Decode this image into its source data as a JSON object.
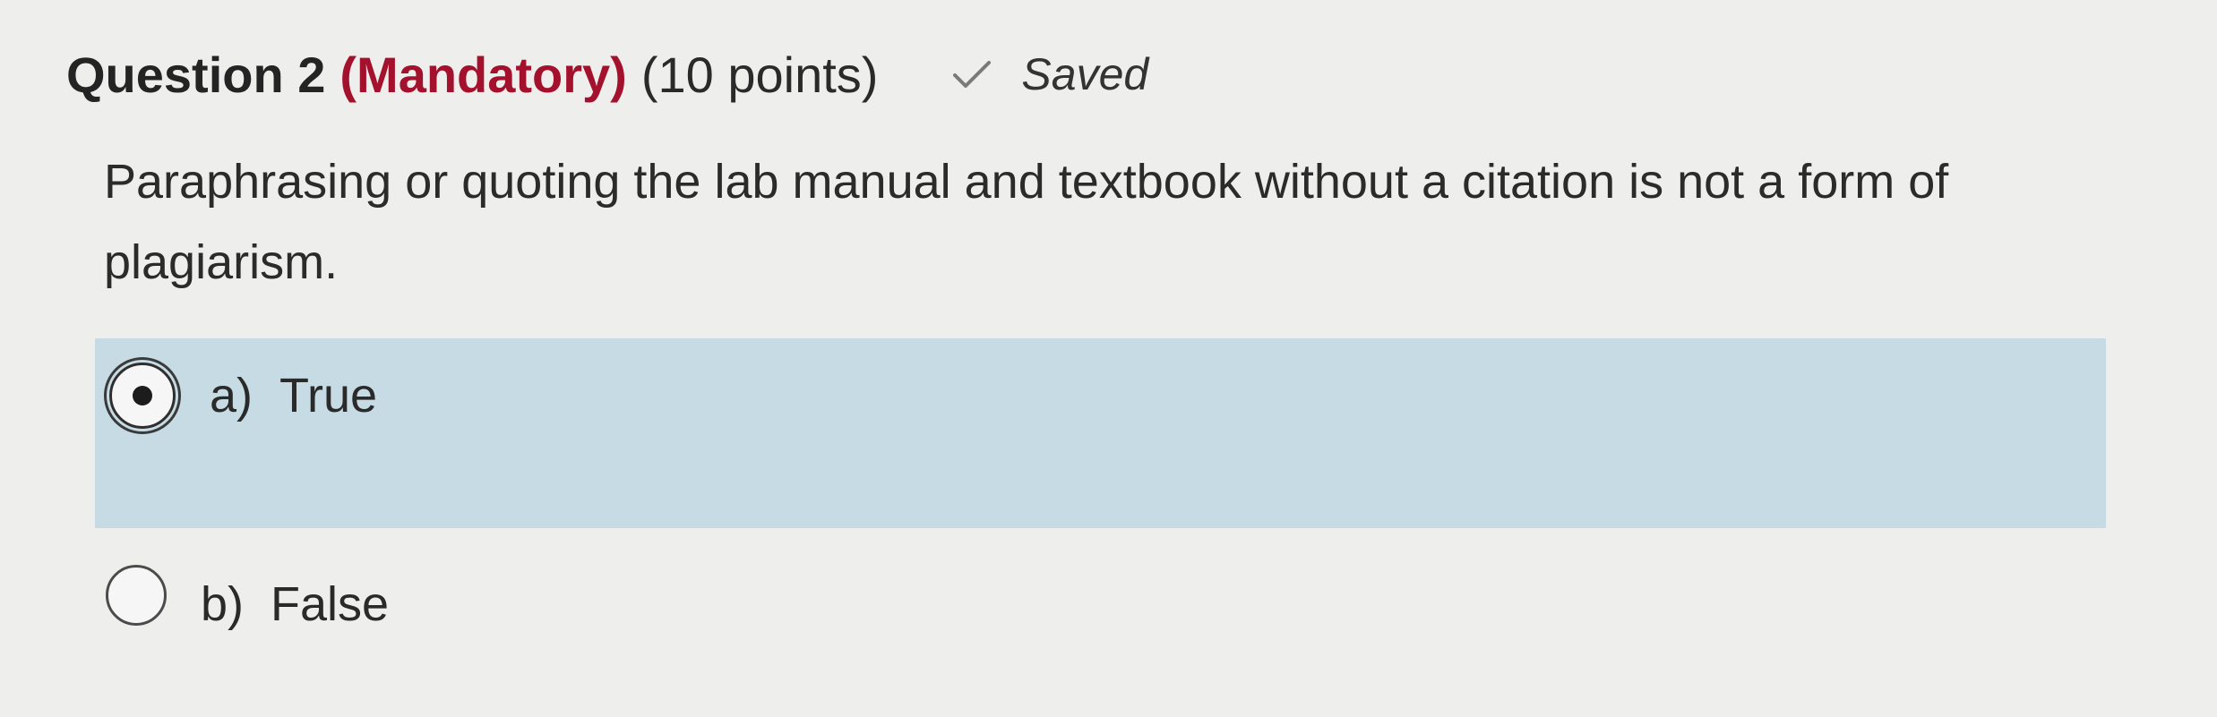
{
  "question": {
    "title": "Question 2",
    "mandatory": "(Mandatory)",
    "points": "(10 points)",
    "status": {
      "icon": "check-icon",
      "label": "Saved"
    },
    "text": "Paraphrasing or quoting the lab manual and textbook without a citation is not a form of plagiarism."
  },
  "options": [
    {
      "letter": "a)",
      "label": "True",
      "selected": true
    },
    {
      "letter": "b)",
      "label": "False",
      "selected": false
    }
  ],
  "colors": {
    "background": "#eeeeed",
    "mandatory": "#a3112d",
    "selected_highlight": "#c6dbe3"
  }
}
